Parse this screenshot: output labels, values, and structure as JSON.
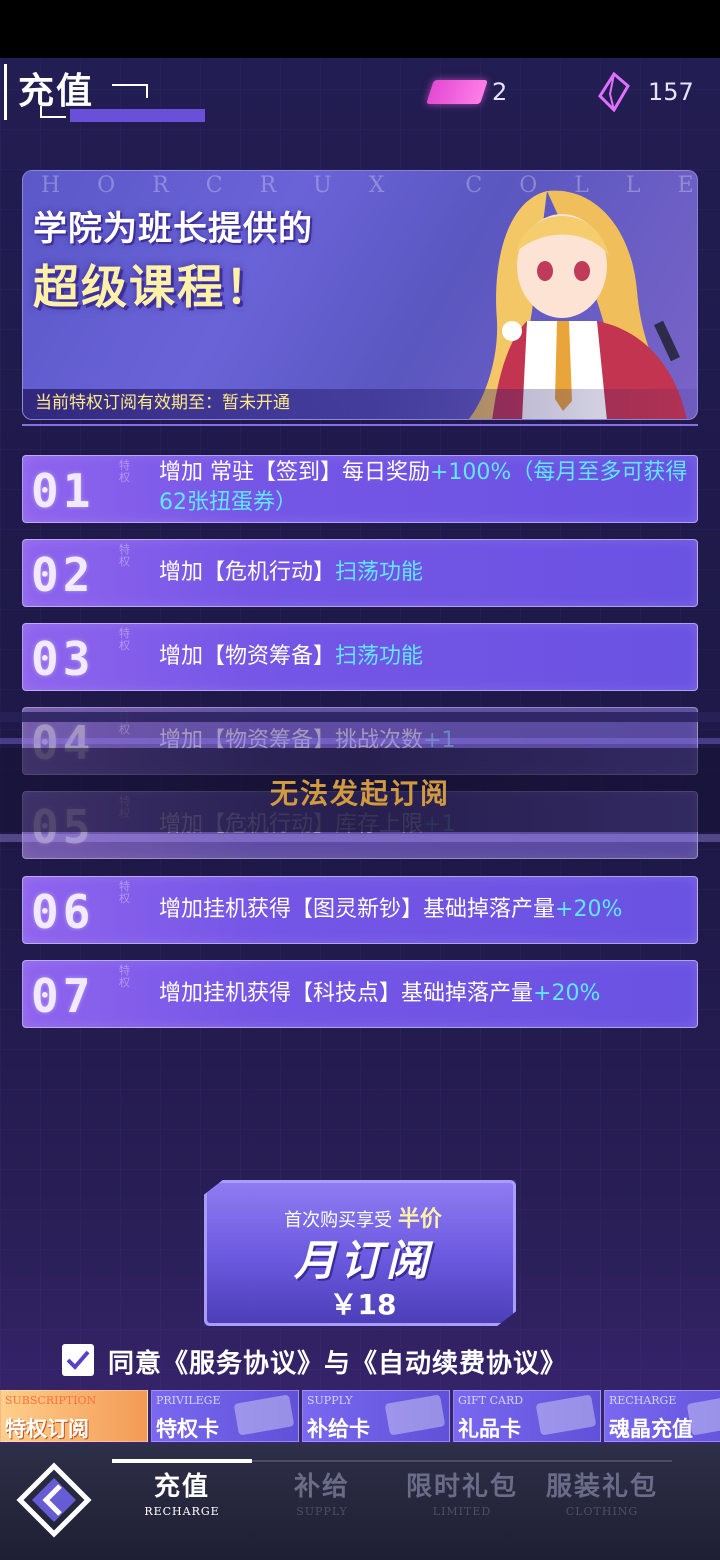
{
  "header": {
    "title": "充值",
    "ticket_count": "2",
    "crystal_count": "157"
  },
  "banner": {
    "watermark": "HORCRUX COLLEGE",
    "line1": "学院为班长提供的",
    "line2": "超级课程！",
    "expiry": "当前特权订阅有效期至：暂未开通"
  },
  "privileges": [
    {
      "num": "01",
      "text": "增加 常驻【签到】每日奖励",
      "highlight": "+100%（每月至多可获得62张扭蛋券）"
    },
    {
      "num": "02",
      "text": "增加【危机行动】",
      "highlight": "扫荡功能"
    },
    {
      "num": "03",
      "text": "增加【物资筹备】",
      "highlight": "扫荡功能"
    },
    {
      "num": "04",
      "text": "增加【物资筹备】挑战次数",
      "highlight": "+1"
    },
    {
      "num": "05",
      "text": "增加【危机行动】库存上限",
      "highlight": "+1"
    },
    {
      "num": "06",
      "text": "增加挂机获得【图灵新钞】基础掉落产量",
      "highlight": "+20%"
    },
    {
      "num": "07",
      "text": "增加挂机获得【科技点】基础掉落产量",
      "highlight": "+20%"
    }
  ],
  "privilege_tag": "特权",
  "toast": "无法发起订阅",
  "subscribe": {
    "tagline_prefix": "首次购买享受",
    "tagline_emphasis": "半价",
    "title": "月订阅",
    "price": "￥18"
  },
  "agreement": {
    "text": "同意《服务协议》与《自动续费协议》",
    "checked": true
  },
  "categories": [
    {
      "en": "SUBSCRIPTION",
      "zh": "特权订阅",
      "active": true
    },
    {
      "en": "PRIVILEGE",
      "zh": "特权卡",
      "active": false
    },
    {
      "en": "SUPPLY",
      "zh": "补给卡",
      "active": false
    },
    {
      "en": "GIFT CARD",
      "zh": "礼品卡",
      "active": false
    },
    {
      "en": "RECHARGE",
      "zh": "魂晶充值",
      "active": false
    }
  ],
  "nav": [
    {
      "zh": "充值",
      "en": "RECHARGE",
      "active": true
    },
    {
      "zh": "补给",
      "en": "SUPPLY",
      "active": false
    },
    {
      "zh": "限时礼包",
      "en": "LIMITED",
      "active": false
    },
    {
      "zh": "服装礼包",
      "en": "CLOTHING",
      "active": false
    }
  ],
  "colors": {
    "accent": "#6a52e2",
    "highlight": "#5fe8ff",
    "gold": "#fff2a8",
    "toast": "#d19a40",
    "active_category": "#f39a56"
  }
}
